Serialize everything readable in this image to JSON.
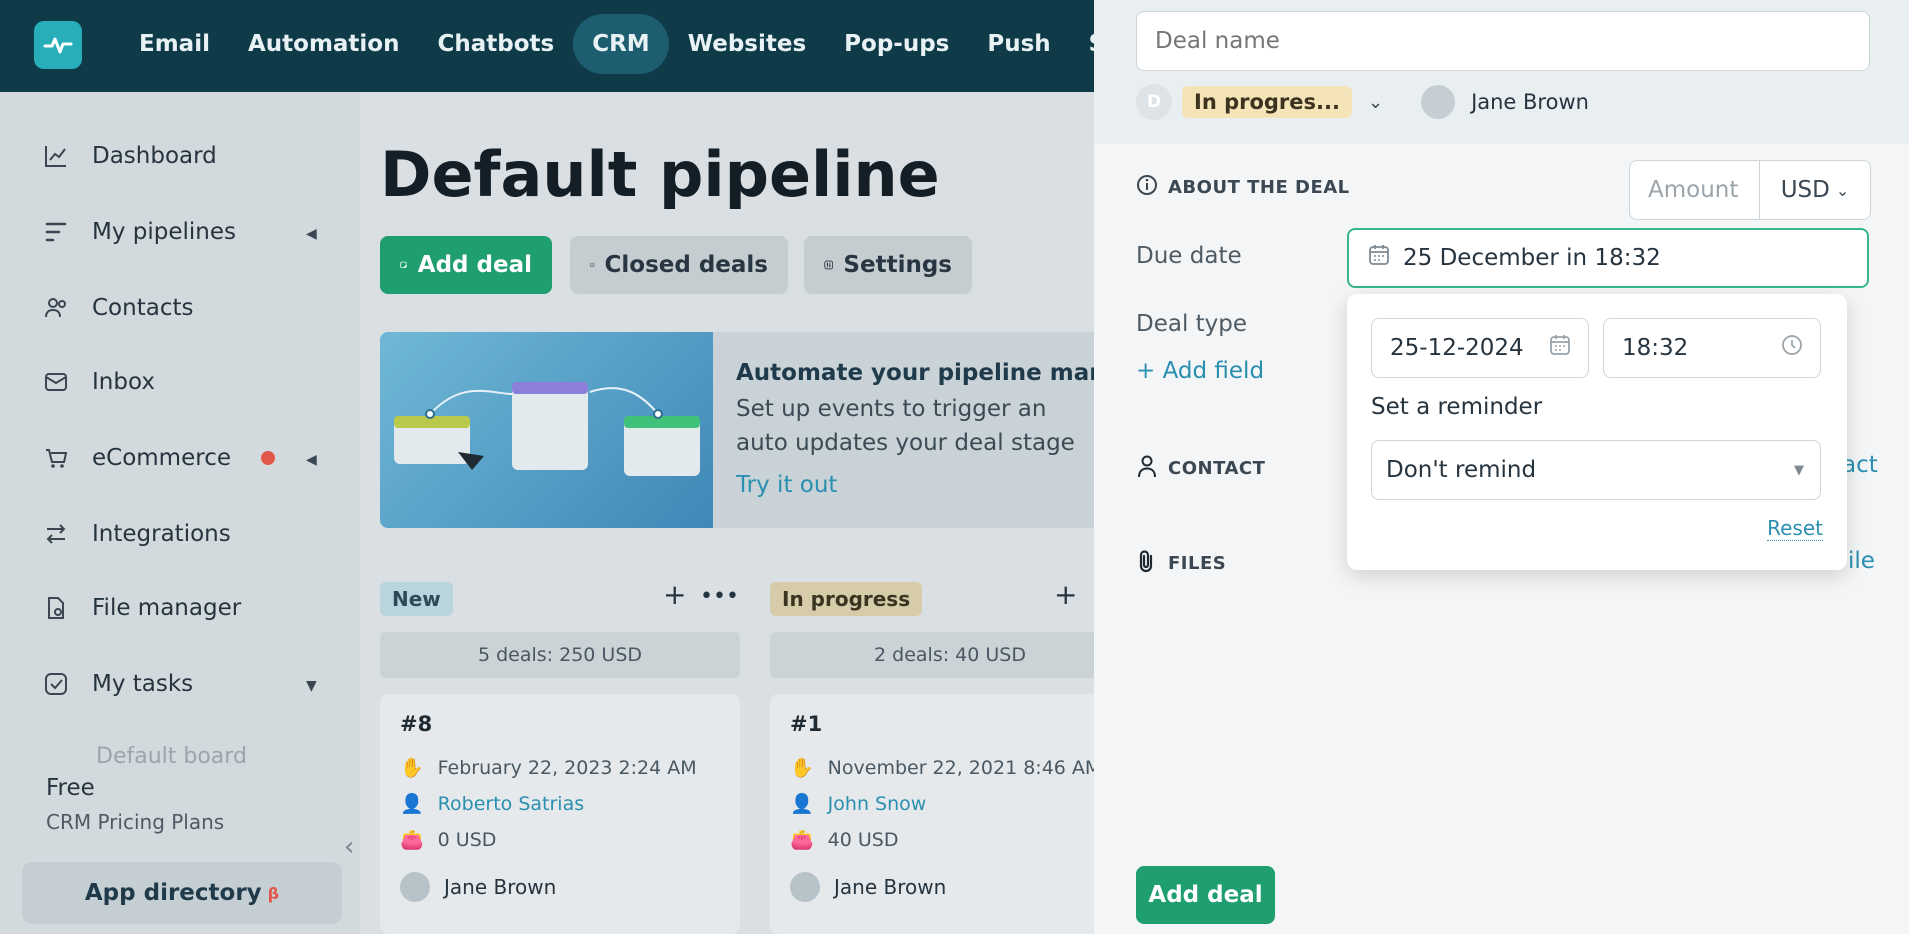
{
  "nav": {
    "items": [
      {
        "label": "Email"
      },
      {
        "label": "Automation"
      },
      {
        "label": "Chatbots"
      },
      {
        "label": "CRM",
        "active": true
      },
      {
        "label": "Websites"
      },
      {
        "label": "Pop-ups"
      },
      {
        "label": "Push"
      },
      {
        "label": "S"
      }
    ]
  },
  "sidebar": {
    "items": [
      {
        "label": "Dashboard",
        "icon": "chart-line-icon"
      },
      {
        "label": "My pipelines",
        "icon": "pipeline-icon"
      },
      {
        "label": "Contacts",
        "icon": "contacts-icon"
      },
      {
        "label": "Inbox",
        "icon": "inbox-icon"
      },
      {
        "label": "eCommerce",
        "icon": "cart-icon"
      },
      {
        "label": "Integrations",
        "icon": "arrows-icon"
      },
      {
        "label": "File manager",
        "icon": "file-icon"
      },
      {
        "label": "My tasks",
        "icon": "check-icon"
      }
    ],
    "faded_item": "Default board",
    "plan": "Free",
    "plan_sub": "CRM Pricing Plans",
    "app_directory": "App directory",
    "beta": "β"
  },
  "main": {
    "title": "Default pipeline",
    "add_deal": "Add deal",
    "closed_deals": "Closed deals",
    "settings": "Settings",
    "banner": {
      "title": "Automate your pipeline manage",
      "text": "Set up events to trigger an auto updates your deal stage",
      "link": "Try it out"
    },
    "columns": [
      {
        "tag": "New",
        "summary": "5 deals: 250 USD",
        "card": {
          "id": "#8",
          "date": "February 22, 2023 2:24 AM",
          "contact": "Roberto Satrias",
          "amount": "0 USD",
          "owner": "Jane Brown"
        }
      },
      {
        "tag": "In progress",
        "summary": "2 deals: 40 USD",
        "card": {
          "id": "#1",
          "date": "November 22, 2021 8:46 AM",
          "contact": "John Snow",
          "amount": "40 USD",
          "owner": "Jane Brown"
        }
      }
    ]
  },
  "panel": {
    "deal_name_placeholder": "Deal name",
    "stage_initial": "D",
    "stage": "In progres...",
    "owner": "Jane Brown",
    "about_header": "ABOUT THE DEAL",
    "amount_placeholder": "Amount",
    "currency": "USD",
    "due_date_label": "Due date",
    "due_date_value": "25 December in 18:32",
    "deal_type_label": "Deal type",
    "add_field": "+ Add field",
    "contact_header": "CONTACT",
    "contact_link": "act",
    "files_header": "FILES",
    "files_link": "ile",
    "popup": {
      "date": "25-12-2024",
      "time": "18:32",
      "reminder_label": "Set a reminder",
      "reminder_value": "Don't remind",
      "reset": "Reset"
    },
    "add_deal_button": "Add deal"
  }
}
